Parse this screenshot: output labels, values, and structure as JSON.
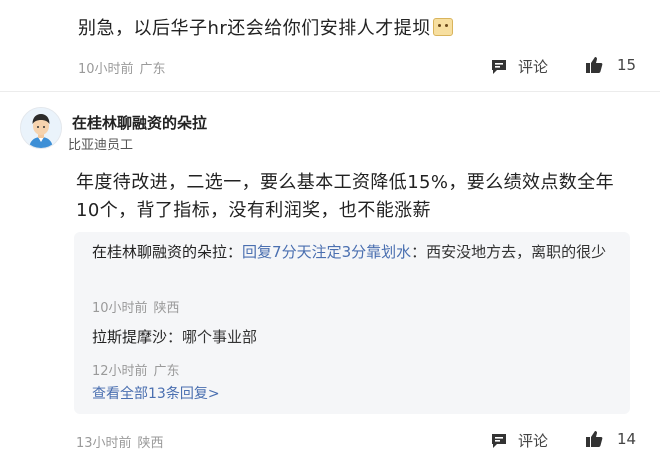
{
  "top_comment": {
    "text": "别急，以后华子hr还会给你们安排人才提坝",
    "emoji_icon": "sweat-smile-emoji",
    "time": "10小时前",
    "location": "广东",
    "comment_label": "评论",
    "like_count": "15"
  },
  "main_comment": {
    "author": "在桂林聊融资的朵拉",
    "company": "比亚迪员工",
    "text": "年度待改进，二选一，要么基本工资降低15%，要么绩效点数全年10个，背了指标，没有利润奖，也不能涨薪",
    "replies": [
      {
        "name": "在桂林聊融资的朵拉",
        "reply_prefix": "回复",
        "target": "7分天注定3分靠划水",
        "text": "西安没地方去，离职的很少",
        "time": "10小时前",
        "location": "陕西"
      },
      {
        "name": "拉斯提摩沙",
        "text": "哪个事业部",
        "time": "12小时前",
        "location": "广东"
      }
    ],
    "view_all": "查看全部13条回复>",
    "time": "13小时前",
    "location": "陕西",
    "comment_label": "评论",
    "like_count": "14"
  },
  "colors": {
    "link": "#4a6fb0",
    "meta": "#9a9a9a",
    "reply_bg": "#f5f6f8"
  }
}
